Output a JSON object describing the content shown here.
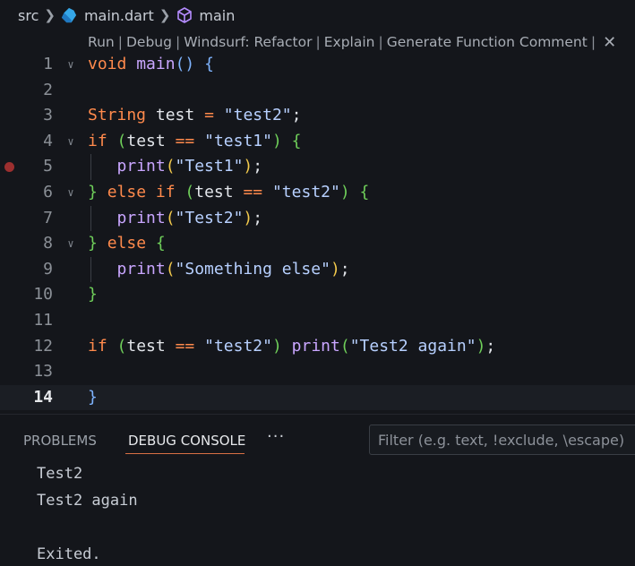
{
  "breadcrumb": {
    "folder": "src",
    "file": "main.dart",
    "symbol": "main"
  },
  "codelens": {
    "run": "Run",
    "debug": "Debug",
    "refactor": "Windsurf: Refactor",
    "explain": "Explain",
    "generate": "Generate Function Comment",
    "pipe": "|",
    "close": "✕"
  },
  "editor": {
    "line_numbers": [
      "1",
      "2",
      "3",
      "4",
      "5",
      "6",
      "7",
      "8",
      "9",
      "10",
      "11",
      "12",
      "13",
      "14"
    ],
    "current_line": "14",
    "breakpoint_line": "5"
  },
  "panel": {
    "tabs": [
      "PROBLEMS",
      "DEBUG CONSOLE"
    ],
    "more": "···",
    "filter_placeholder": "Filter (e.g. text, !exclude, \\escape)",
    "output": [
      "Test2",
      "Test2 again",
      "",
      "Exited."
    ]
  },
  "colors": {
    "background": "#14161b",
    "keyword": "#ff8a4c",
    "function": "#c9a6ff",
    "string": "#b7d0ff",
    "breakpoint": "#9c2f2f",
    "active_tab_underline": "#d86f44"
  }
}
